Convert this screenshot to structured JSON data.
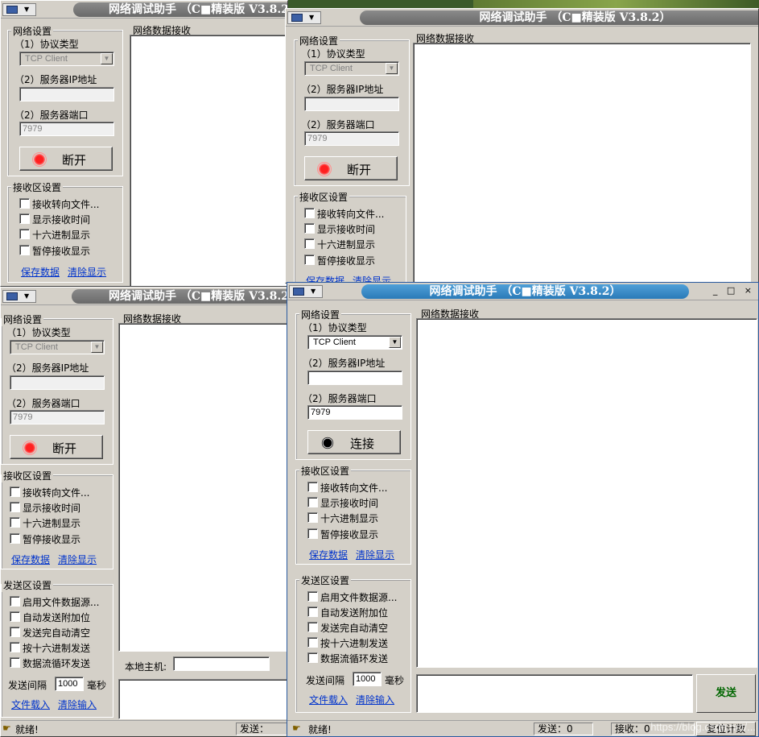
{
  "app": {
    "title": "网络调试助手 （C■精装版 V3.8.2）",
    "title_partial": "网络调试助手 （C■精装版 V3.8.2）",
    "title_clip_bottom_left": "网络调试助手 （C■精装版 V3.8.2）",
    "window_controls": "_ □ ×"
  },
  "net": {
    "group": "网络设置",
    "protocol_label": "（1）协议类型",
    "protocol_value": "TCP Client",
    "ip_label": "（2）服务器IP地址",
    "port_label": "（2）服务器端口",
    "port_value": "7979",
    "disconnect": "断开",
    "connect": "连接"
  },
  "recv": {
    "area_label": "网络数据接收",
    "group": "接收区设置",
    "opts": [
      "接收转向文件...",
      "显示接收时间",
      "十六进制显示",
      "暂停接收显示"
    ],
    "save": "保存数据",
    "clear": "清除显示"
  },
  "send": {
    "group": "发送区设置",
    "opts": [
      "启用文件数据源...",
      "自动发送附加位",
      "发送完自动清空",
      "按十六进制发送",
      "数据流循环发送"
    ],
    "interval_label": "发送间隔",
    "interval_value": "1000",
    "interval_unit": "毫秒",
    "load_file": "文件载入",
    "clear_input": "清除输入",
    "send_button": "发送",
    "local_host_label": "本地主机:"
  },
  "status": {
    "ready": "就绪!",
    "sent_label": "发送：0",
    "sent_label_short": "发送：",
    "recv_label": "接收：0",
    "reset": "复位计数"
  },
  "watermark": "https://blog.csdn.net/..."
}
